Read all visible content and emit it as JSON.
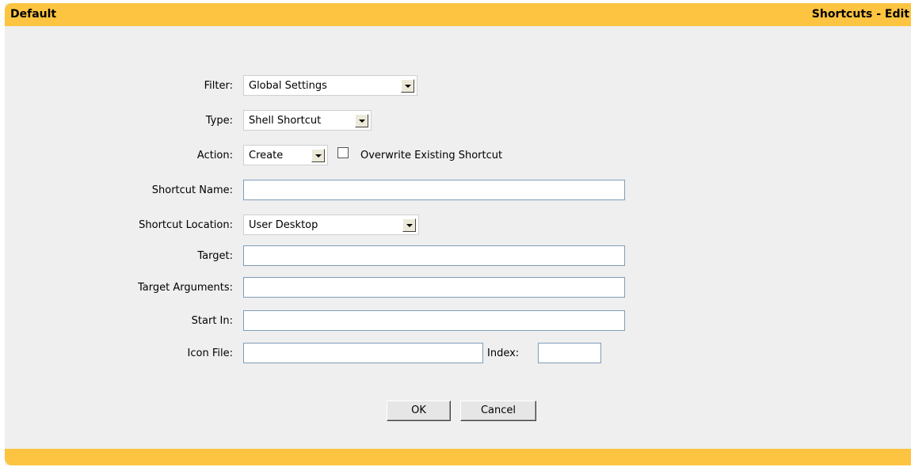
{
  "header": {
    "left_title": "Default",
    "right_title": "Shortcuts - Edit"
  },
  "form": {
    "filter": {
      "label": "Filter:",
      "value": "Global Settings"
    },
    "type": {
      "label": "Type:",
      "value": "Shell Shortcut"
    },
    "action": {
      "label": "Action:",
      "value": "Create",
      "checkbox_label": "Overwrite Existing Shortcut",
      "checkbox_checked": false
    },
    "shortcut_name": {
      "label": "Shortcut Name:",
      "value": ""
    },
    "shortcut_location": {
      "label": "Shortcut Location:",
      "value": "User Desktop"
    },
    "target": {
      "label": "Target:",
      "value": ""
    },
    "target_arguments": {
      "label": "Target Arguments:",
      "value": ""
    },
    "start_in": {
      "label": "Start In:",
      "value": ""
    },
    "icon_file": {
      "label": "Icon File:",
      "value": "",
      "index_label": "Index:",
      "index_value": ""
    }
  },
  "buttons": {
    "ok": "OK",
    "cancel": "Cancel"
  },
  "colors": {
    "bar": "#fcc440",
    "panel": "#efefef"
  }
}
